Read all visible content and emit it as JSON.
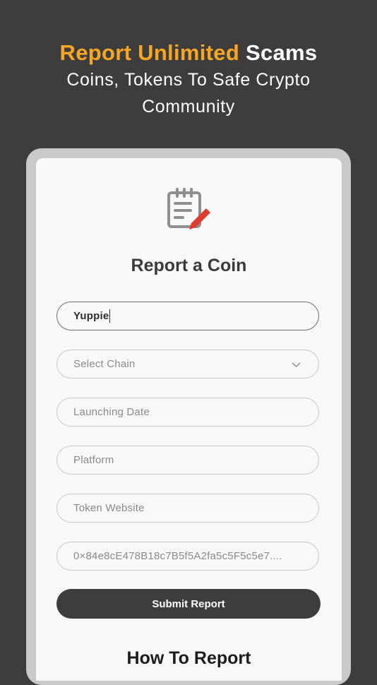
{
  "hero": {
    "accent_text": "Report Unlimited",
    "white_text": "Scams",
    "subtitle_line1": "Coins, Tokens To Safe Crypto",
    "subtitle_line2": "Community"
  },
  "card": {
    "title": "Report a Coin",
    "fields": {
      "coin_name_value": "Yuppie",
      "chain_placeholder": "Select Chain",
      "launching_date_placeholder": "Launching Date",
      "platform_placeholder": "Platform",
      "website_placeholder": "Token Website",
      "contract_address_placeholder": "0×84e8cE478B18c7B5f5A2fa5c5F5c5e7...."
    },
    "submit_label": "Submit Report",
    "how_to_title": "How To Report"
  },
  "colors": {
    "background": "#3d3d3d",
    "accent": "#f6a623",
    "icon_pencil": "#e03b2c"
  },
  "icons": [
    "report-form-icon",
    "chevron-down-icon"
  ]
}
